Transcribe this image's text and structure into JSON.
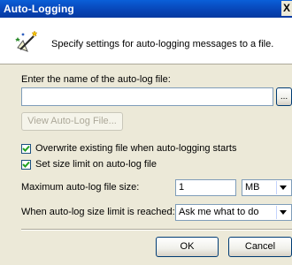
{
  "window": {
    "title": "Auto-Logging",
    "close_glyph": "X"
  },
  "header": {
    "description": "Specify settings for auto-logging messages to a file."
  },
  "file": {
    "label": "Enter the name of the auto-log file:",
    "value": "",
    "browse_label": "...",
    "view_button_label": "View Auto-Log File..."
  },
  "options": {
    "overwrite_label": "Overwrite existing file when auto-logging starts",
    "overwrite_checked": true,
    "size_limit_label": "Set size limit on auto-log file",
    "size_limit_checked": true
  },
  "size": {
    "label": "Maximum auto-log file size:",
    "value": "1",
    "unit": "MB"
  },
  "limit_action": {
    "label": "When auto-log size limit is reached:",
    "value": "Ask me what to do"
  },
  "buttons": {
    "ok": "OK",
    "cancel": "Cancel"
  }
}
